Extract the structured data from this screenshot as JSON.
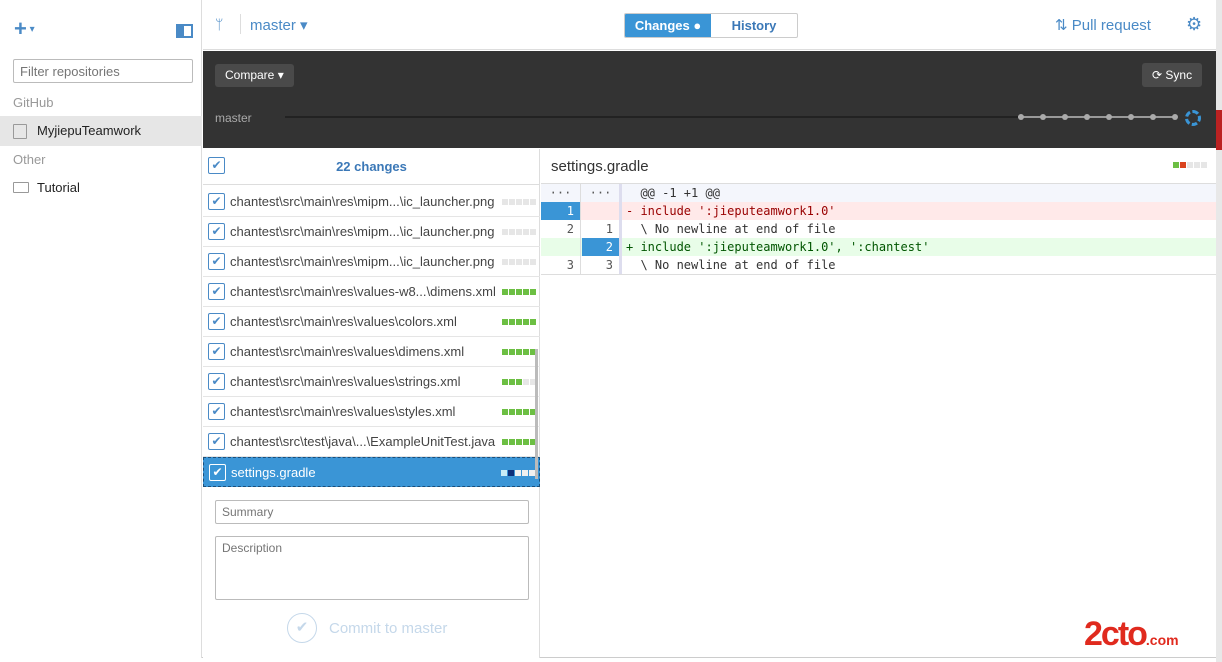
{
  "sidebar": {
    "filter_placeholder": "Filter repositories",
    "sections": [
      {
        "label": "GitHub",
        "repos": [
          "MyjiepuTeamwork"
        ]
      },
      {
        "label": "Other",
        "repos": [
          "Tutorial"
        ]
      }
    ]
  },
  "header": {
    "branch": "master",
    "tabs": [
      "Changes",
      "History"
    ],
    "active_tab": "Changes",
    "pull_request": "Pull request"
  },
  "toolbar": {
    "compare": "Compare",
    "sync": "Sync",
    "timeline_branch": "master",
    "timeline_commits": 8
  },
  "changes": {
    "count_label": "22 changes",
    "files": [
      {
        "name": "chantest\\src\\main\\res\\mipm...\\ic_launcher.png",
        "bars": [
          "e",
          "e",
          "e",
          "e",
          "e"
        ]
      },
      {
        "name": "chantest\\src\\main\\res\\mipm...\\ic_launcher.png",
        "bars": [
          "e",
          "e",
          "e",
          "e",
          "e"
        ]
      },
      {
        "name": "chantest\\src\\main\\res\\mipm...\\ic_launcher.png",
        "bars": [
          "e",
          "e",
          "e",
          "e",
          "e"
        ]
      },
      {
        "name": "chantest\\src\\main\\res\\values-w8...\\dimens.xml",
        "bars": [
          "g",
          "g",
          "g",
          "g",
          "g"
        ]
      },
      {
        "name": "chantest\\src\\main\\res\\values\\colors.xml",
        "bars": [
          "g",
          "g",
          "g",
          "g",
          "g"
        ]
      },
      {
        "name": "chantest\\src\\main\\res\\values\\dimens.xml",
        "bars": [
          "g",
          "g",
          "g",
          "g",
          "g"
        ]
      },
      {
        "name": "chantest\\src\\main\\res\\values\\strings.xml",
        "bars": [
          "g",
          "g",
          "g",
          "e",
          "e"
        ]
      },
      {
        "name": "chantest\\src\\main\\res\\values\\styles.xml",
        "bars": [
          "g",
          "g",
          "g",
          "g",
          "g"
        ]
      },
      {
        "name": "chantest\\src\\test\\java\\...\\ExampleUnitTest.java",
        "bars": [
          "g",
          "g",
          "g",
          "g",
          "g"
        ]
      },
      {
        "name": "settings.gradle",
        "bars": [
          "l",
          "b",
          "w",
          "w",
          "w"
        ],
        "selected": true
      }
    ]
  },
  "commit": {
    "summary_placeholder": "Summary",
    "description_placeholder": "Description",
    "button": "Commit to master"
  },
  "diff": {
    "file": "settings.gradle",
    "stat": [
      "g",
      "r",
      "e",
      "e",
      "e"
    ],
    "lines": [
      {
        "type": "hunk",
        "old": "···",
        "new": "···",
        "text": "  @@ -1 +1 @@"
      },
      {
        "type": "del",
        "old": "1",
        "new": "",
        "text": "- include ':jieputeamwork1.0'"
      },
      {
        "type": "ctx",
        "old": "2",
        "new": "1",
        "text": "  \\ No newline at end of file"
      },
      {
        "type": "add",
        "old": "",
        "new": "2",
        "text": "+ include ':jieputeamwork1.0', ':chantest'"
      },
      {
        "type": "ctx",
        "old": "3",
        "new": "3",
        "text": "  \\ No newline at end of file"
      }
    ]
  },
  "colors": {
    "accent": "#3a95d6",
    "green": "#6cbf43",
    "red": "#d9431e",
    "empty": "#e6e6e6",
    "navy": "#0d2f7a"
  },
  "watermark": "2cto.com 红黑联盟"
}
